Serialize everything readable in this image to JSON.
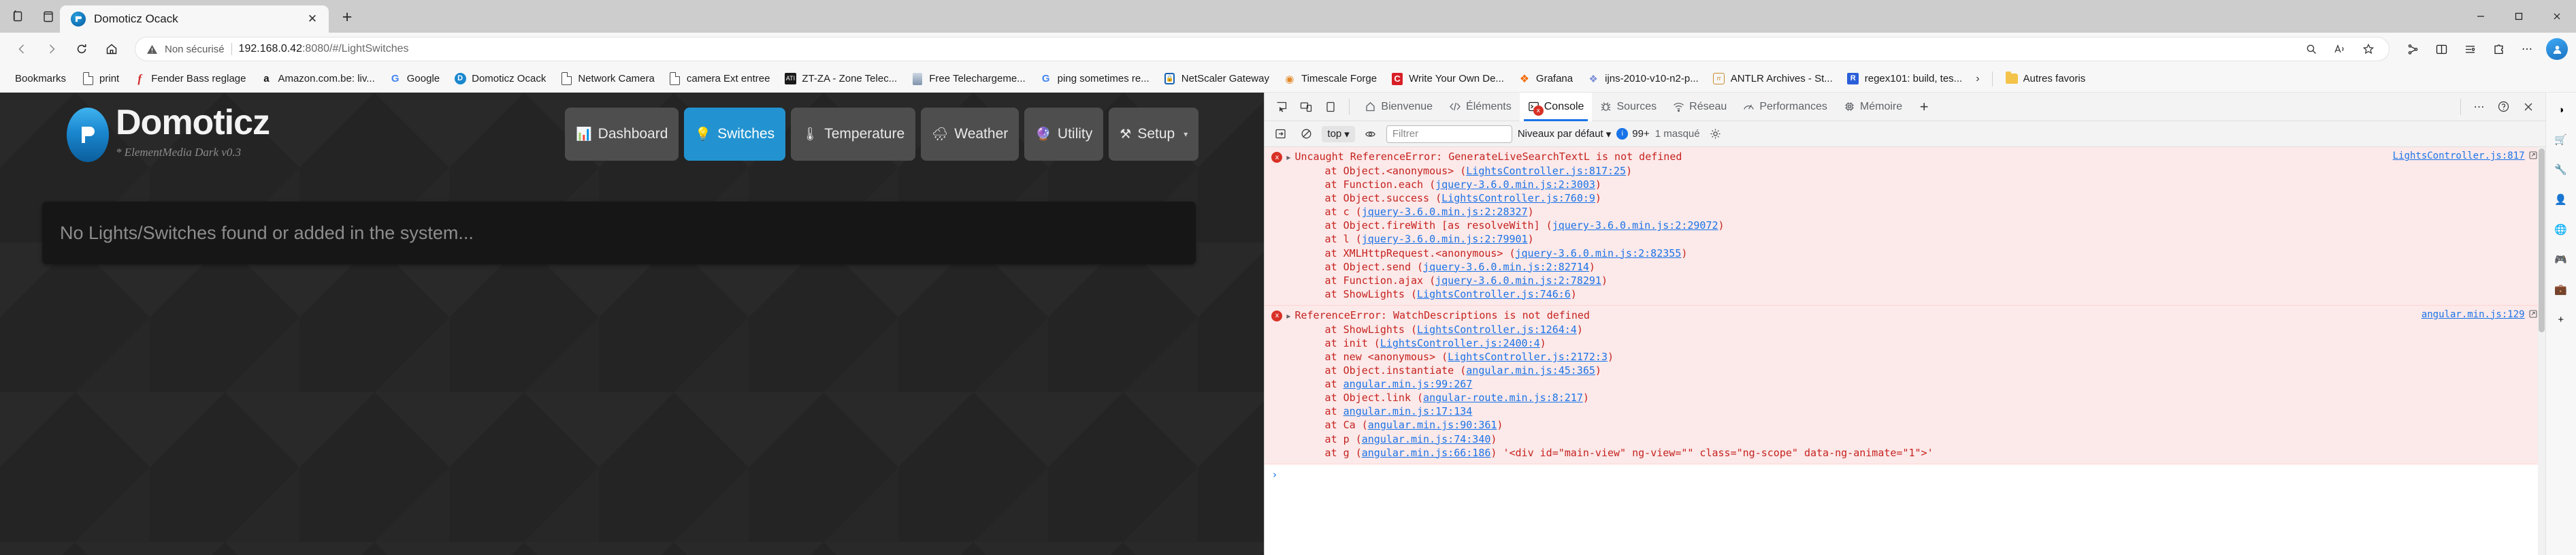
{
  "browser": {
    "tab": {
      "title": "Domoticz Ocack",
      "favicon": "domoticz-favicon",
      "close_label": "✕"
    },
    "newtab_label": "+",
    "window_controls": {
      "minimize": "–",
      "maximize": "❐",
      "close": "✕"
    },
    "omnibox": {
      "security_label": "Non sécurisé",
      "url_host": "192.168.0.42",
      "url_rest": ":8080/#/LightSwitches",
      "url_full": "192.168.0.42:8080/#/LightSwitches"
    },
    "bookmarks_label": "Bookmarks",
    "bookmarks": [
      {
        "label": "print",
        "icon": "doc-icon"
      },
      {
        "label": "Fender Bass reglage",
        "icon": "fender-icon"
      },
      {
        "label": "Amazon.com.be: liv...",
        "icon": "amazon-icon"
      },
      {
        "label": "Google",
        "icon": "google-icon"
      },
      {
        "label": "Domoticz Ocack",
        "icon": "domoticz-icon"
      },
      {
        "label": "Network Camera",
        "icon": "doc-icon"
      },
      {
        "label": "camera Ext entree",
        "icon": "doc-icon"
      },
      {
        "label": "ZT-ZA - Zone Telec...",
        "icon": "ati-icon"
      },
      {
        "label": "Free Telechargeme...",
        "icon": "free-icon"
      },
      {
        "label": "ping sometimes re...",
        "icon": "google-icon"
      },
      {
        "label": "NetScaler Gateway",
        "icon": "lock-icon"
      },
      {
        "label": "Timescale Forge",
        "icon": "timescale-icon"
      },
      {
        "label": "Write Your Own De...",
        "icon": "c-icon"
      },
      {
        "label": "Grafana",
        "icon": "grafana-icon"
      },
      {
        "label": "ijns-2010-v10-n2-p...",
        "icon": "cluster-icon"
      },
      {
        "label": "ANTLR Archives - St...",
        "icon": "antlr-icon"
      },
      {
        "label": "regex101: build, tes...",
        "icon": "regex-icon"
      }
    ],
    "bookmarks_overflow": "›",
    "other_favorites": {
      "label": "Autres favoris",
      "icon": "folder-icon"
    }
  },
  "domoticz": {
    "brand_name": "Domoticz",
    "brand_sub": "* ElementMedia Dark v0.3",
    "logo_glyph": "Ʋ",
    "nav": [
      {
        "label": "Dashboard",
        "icon": "dashboard-icon",
        "glyph": "📊",
        "active": false
      },
      {
        "label": "Switches",
        "icon": "lightbulb-icon",
        "glyph": "💡",
        "active": true
      },
      {
        "label": "Temperature",
        "icon": "thermometer-icon",
        "glyph": "🌡",
        "active": false
      },
      {
        "label": "Weather",
        "icon": "rain-cloud-icon",
        "glyph": "🌧",
        "active": false
      },
      {
        "label": "Utility",
        "icon": "utility-icon",
        "glyph": "🔮",
        "active": false
      },
      {
        "label": "Setup",
        "icon": "tools-icon",
        "glyph": "⚒",
        "active": false,
        "caret": "▾"
      }
    ],
    "empty_message": "No Lights/Switches found or added in the system..."
  },
  "devtools": {
    "left_tools": [
      {
        "name": "inspect-element-icon"
      },
      {
        "name": "device-toolbar-icon"
      },
      {
        "name": "dock-side-icon"
      }
    ],
    "tabs": [
      {
        "label": "Bienvenue",
        "icon": "home-icon",
        "active": false
      },
      {
        "label": "Éléments",
        "icon": "code-icon",
        "active": false
      },
      {
        "label": "Console",
        "icon": "console-icon",
        "active": true,
        "error_badge": "x"
      },
      {
        "label": "Sources",
        "icon": "bug-icon",
        "active": false
      },
      {
        "label": "Réseau",
        "icon": "network-icon",
        "active": false
      },
      {
        "label": "Performances",
        "icon": "performance-icon",
        "active": false
      },
      {
        "label": "Mémoire",
        "icon": "memory-icon",
        "active": false
      }
    ],
    "add_tab_label": "+",
    "more_label": "⋯",
    "help_label": "?",
    "close_label": "✕",
    "filterbar": {
      "clear_console_icon": "clear-console-icon",
      "no_entry_icon": "no-entry-icon",
      "context": "top",
      "context_caret": "▾",
      "eye_icon": "live-expression-icon",
      "filter_placeholder": "Filtrer",
      "filter_value": "",
      "levels_label": "Niveaux par défaut",
      "levels_caret": "▾",
      "error_count": "99+",
      "hidden_label": "1 masqué",
      "settings_icon": "gear-icon"
    },
    "messages": [
      {
        "title": "Uncaught ReferenceError: GenerateLiveSearchTextL is not defined",
        "origin": "LightsController.js:817",
        "stack": [
          {
            "fn": "    at Object.<anonymous> (",
            "link": "LightsController.js:817:25",
            "tail": ")"
          },
          {
            "fn": "    at Function.each (",
            "link": "jquery-3.6.0.min.js:2:3003",
            "tail": ")"
          },
          {
            "fn": "    at Object.success (",
            "link": "LightsController.js:760:9",
            "tail": ")"
          },
          {
            "fn": "    at c (",
            "link": "jquery-3.6.0.min.js:2:28327",
            "tail": ")"
          },
          {
            "fn": "    at Object.fireWith [as resolveWith] (",
            "link": "jquery-3.6.0.min.js:2:29072",
            "tail": ")"
          },
          {
            "fn": "    at l (",
            "link": "jquery-3.6.0.min.js:2:79901",
            "tail": ")"
          },
          {
            "fn": "    at XMLHttpRequest.<anonymous> (",
            "link": "jquery-3.6.0.min.js:2:82355",
            "tail": ")"
          },
          {
            "fn": "    at Object.send (",
            "link": "jquery-3.6.0.min.js:2:82714",
            "tail": ")"
          },
          {
            "fn": "    at Function.ajax (",
            "link": "jquery-3.6.0.min.js:2:78291",
            "tail": ")"
          },
          {
            "fn": "    at ShowLights (",
            "link": "LightsController.js:746:6",
            "tail": ")"
          }
        ]
      },
      {
        "title": "ReferenceError: WatchDescriptions is not defined",
        "origin": "angular.min.js:129",
        "stack": [
          {
            "fn": "    at ShowLights (",
            "link": "LightsController.js:1264:4",
            "tail": ")"
          },
          {
            "fn": "    at init (",
            "link": "LightsController.js:2400:4",
            "tail": ")"
          },
          {
            "fn": "    at new <anonymous> (",
            "link": "LightsController.js:2172:3",
            "tail": ")"
          },
          {
            "fn": "    at Object.instantiate (",
            "link": "angular.min.js:45:365",
            "tail": ")"
          },
          {
            "fn": "    at ",
            "link": "angular.min.js:99:267",
            "tail": ""
          },
          {
            "fn": "    at Object.link (",
            "link": "angular-route.min.js:8:217",
            "tail": ")"
          },
          {
            "fn": "    at ",
            "link": "angular.min.js:17:134",
            "tail": ""
          },
          {
            "fn": "    at Ca (",
            "link": "angular.min.js:90:361",
            "tail": ")"
          },
          {
            "fn": "    at p (",
            "link": "angular.min.js:74:340",
            "tail": ")"
          },
          {
            "fn": "    at g (",
            "link": "angular.min.js:66:186",
            "tail": ") '<div id=\"main-view\" ng-view=\"\" class=\"ng-scope\" data-ng-animate=\"1\">'"
          }
        ]
      }
    ],
    "prompt_caret": "›"
  },
  "edge_rail": [
    {
      "icon": "copilot-icon",
      "glyph": "◑"
    },
    {
      "icon": "shopping-icon",
      "glyph": "🛒"
    },
    {
      "icon": "tools-icon",
      "glyph": "🔧"
    },
    {
      "icon": "user-icon",
      "glyph": "👤"
    },
    {
      "icon": "globe-icon",
      "glyph": "🌐"
    },
    {
      "icon": "game-icon",
      "glyph": "🎮"
    },
    {
      "icon": "bag-icon",
      "glyph": "💼"
    },
    {
      "icon": "add-icon",
      "glyph": "+"
    }
  ],
  "colors": {
    "accent_blue": "#1a73e8",
    "error_red": "#c5221f",
    "error_bg": "#fce9e9",
    "domoticz_active": "#2293d0",
    "page_bg": "#242424"
  }
}
